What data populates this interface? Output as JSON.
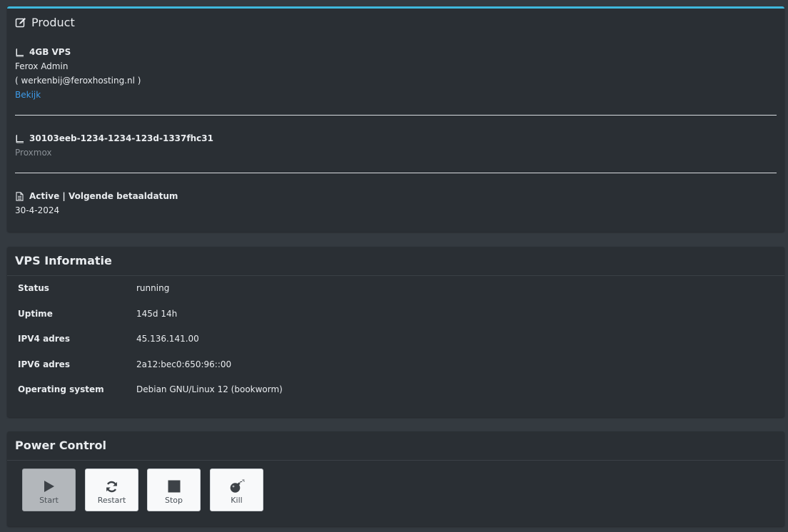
{
  "product": {
    "title": "Product",
    "plan": {
      "name": "4GB VPS",
      "owner": "Ferox Admin",
      "email": "( werkenbij@feroxhosting.nl )",
      "link": "Bekijk"
    },
    "service": {
      "id": "30103eeb-1234-1234-123d-1337fhc31",
      "type": "Proxmox"
    },
    "billing": {
      "status": "Active | Volgende betaaldatum",
      "date": "30-4-2024"
    }
  },
  "vps": {
    "title": "VPS Informatie",
    "rows": [
      {
        "label": "Status",
        "value": "running"
      },
      {
        "label": "Uptime",
        "value": "145d 14h"
      },
      {
        "label": "IPV4 adres",
        "value": "45.136.141.00"
      },
      {
        "label": "IPV6 adres",
        "value": "2a12:bec0:650:96::00"
      },
      {
        "label": "Operating system",
        "value": "Debian GNU/Linux 12 (bookworm)"
      }
    ]
  },
  "power": {
    "title": "Power Control",
    "buttons": [
      {
        "label": "Start",
        "icon": "play-icon",
        "disabled": true
      },
      {
        "label": "Restart",
        "icon": "refresh-icon",
        "disabled": false
      },
      {
        "label": "Stop",
        "icon": "stop-icon",
        "disabled": false
      },
      {
        "label": "Kill",
        "icon": "bomb-icon",
        "disabled": false
      }
    ]
  },
  "colors": {
    "accent": "#3fb8dd",
    "link": "#3d9be9",
    "card": "#2a2f34",
    "background": "#343a40"
  }
}
